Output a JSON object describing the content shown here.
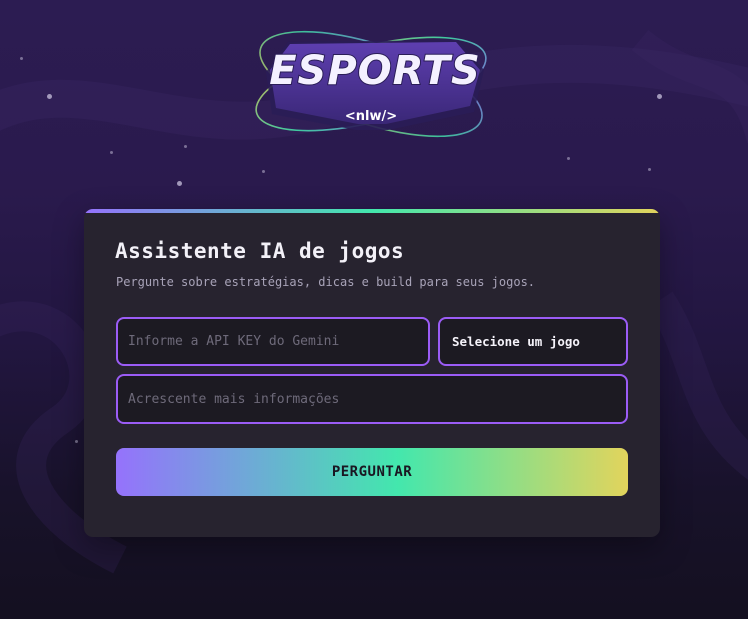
{
  "logo": {
    "title": "ESPORTS",
    "subtitle": "<nlw/>"
  },
  "card": {
    "title": "Assistente IA de jogos",
    "subtitle": "Pergunte sobre estratégias, dicas e build para seus jogos."
  },
  "form": {
    "api_key_placeholder": "Informe a API KEY do Gemini",
    "game_select_value": "Selecione um jogo",
    "info_placeholder": "Acrescente mais informações",
    "submit_label": "PERGUNTAR"
  },
  "colors": {
    "accent_purple": "#9572fc",
    "accent_green": "#43e7ad",
    "accent_yellow": "#e2d45c",
    "field_border": "#9b5cf6",
    "card_background": "#27232f"
  }
}
